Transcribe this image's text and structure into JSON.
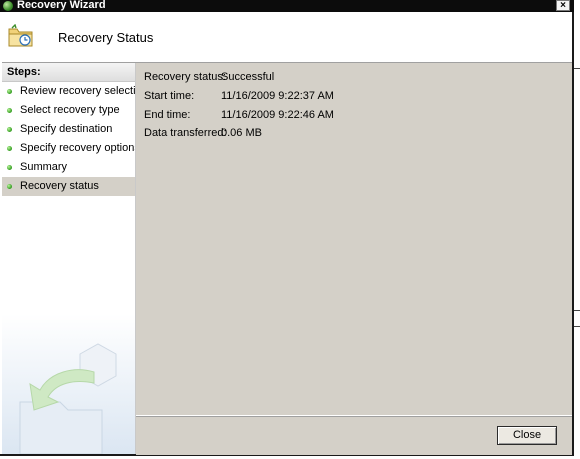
{
  "window": {
    "title": "Recovery Wizard",
    "close_glyph": "×"
  },
  "header": {
    "title": "Recovery Status",
    "icon": "folder-recovery-icon"
  },
  "sidebar": {
    "heading": "Steps:",
    "items": [
      {
        "label": "Review recovery selection",
        "active": false
      },
      {
        "label": "Select recovery type",
        "active": false
      },
      {
        "label": "Specify destination",
        "active": false
      },
      {
        "label": "Specify recovery options",
        "active": false
      },
      {
        "label": "Summary",
        "active": false
      },
      {
        "label": "Recovery status",
        "active": true
      }
    ]
  },
  "status": {
    "recovery_status_label": "Recovery status:",
    "recovery_status_value": "Successful",
    "start_time_label": "Start time:",
    "start_time_value": "11/16/2009 9:22:37 AM",
    "end_time_label": "End time:",
    "end_time_value": "11/16/2009 9:22:46 AM",
    "data_transferred_label": "Data transferred:",
    "data_transferred_value": "0.06 MB"
  },
  "footer": {
    "close_label": "Close"
  },
  "colors": {
    "panel": "#d4d0c8",
    "titlebar": "#0c0c0c",
    "step_dot": "#2f9a1d"
  }
}
